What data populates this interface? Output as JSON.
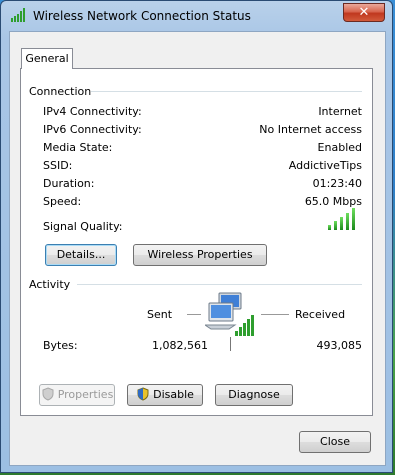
{
  "window": {
    "title": "Wireless Network Connection Status",
    "close_glyph": "✕",
    "title_icon": "signal-bars-icon"
  },
  "tabs": [
    {
      "label": "General",
      "selected": true
    }
  ],
  "connection": {
    "heading": "Connection",
    "rows": [
      {
        "label": "IPv4 Connectivity:",
        "value": "Internet"
      },
      {
        "label": "IPv6 Connectivity:",
        "value": "No Internet access"
      },
      {
        "label": "Media State:",
        "value": "Enabled"
      },
      {
        "label": "SSID:",
        "value": "AddictiveTips"
      },
      {
        "label": "Duration:",
        "value": "01:23:40"
      },
      {
        "label": "Speed:",
        "value": "65.0 Mbps"
      }
    ],
    "signal_quality_label": "Signal Quality:",
    "signal_level": "5 of 5 bars"
  },
  "connection_buttons": {
    "details": "Details...",
    "wireless_properties": "Wireless Properties"
  },
  "activity": {
    "heading": "Activity",
    "sent_label": "Sent",
    "received_label": "Received",
    "bytes_label": "Bytes:",
    "bytes_sent": "1,082,561",
    "bytes_received": "493,085"
  },
  "activity_buttons": {
    "properties": "Properties",
    "disable": "Disable",
    "diagnose": "Diagnose"
  },
  "footer": {
    "close": "Close"
  },
  "colors": {
    "signal_green": "#2e9e2e",
    "close_red": "#c0381f",
    "focus_blue": "#3c7fb1"
  }
}
